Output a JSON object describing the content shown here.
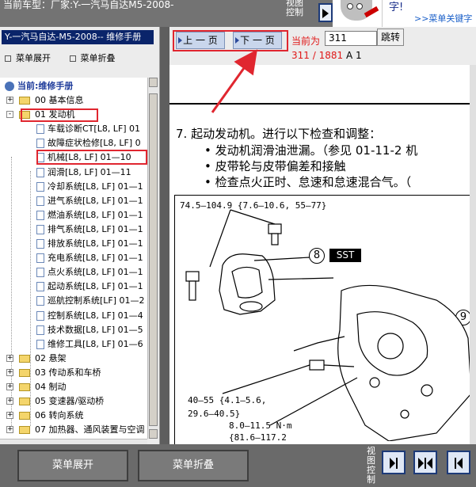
{
  "top": {
    "car_model": "当前车型：厂家:Y-一汽马自达M5-2008-",
    "view_control": "视图控制",
    "bubble_text": "字!",
    "bubble_link": ">>菜单关键字"
  },
  "left_panel": {
    "title": "Y-一汽马自达-M5-2008-- 维修手册",
    "expand_label": "菜单展开",
    "collapse_label": "菜单折叠",
    "current_label": "当前:维修手册",
    "tree": [
      {
        "label": "00 基本信息",
        "type": "folder",
        "level": 0,
        "expander": "+"
      },
      {
        "label": "01 发动机",
        "type": "folder",
        "level": 0,
        "expander": "-",
        "selected": true
      },
      {
        "label": "车载诊断CT[L8, LF] 01",
        "type": "doc",
        "level": 1
      },
      {
        "label": "故障症状检修[L8, LF] 0",
        "type": "doc",
        "level": 1
      },
      {
        "label": "机械[L8, LF] 01—10",
        "type": "doc",
        "level": 1,
        "active": true
      },
      {
        "label": "润滑[L8, LF] 01—11",
        "type": "doc",
        "level": 1
      },
      {
        "label": "冷却系统[L8, LF] 01—1",
        "type": "doc",
        "level": 1
      },
      {
        "label": "进气系统[L8, LF] 01—1",
        "type": "doc",
        "level": 1
      },
      {
        "label": "燃油系统[L8, LF] 01—1",
        "type": "doc",
        "level": 1
      },
      {
        "label": "排气系统[L8, LF] 01—1",
        "type": "doc",
        "level": 1
      },
      {
        "label": "排放系统[L8, LF] 01—1",
        "type": "doc",
        "level": 1
      },
      {
        "label": "充电系统[L8, LF] 01—1",
        "type": "doc",
        "level": 1
      },
      {
        "label": "点火系统[L8, LF] 01—1",
        "type": "doc",
        "level": 1
      },
      {
        "label": "起动系统[L8, LF] 01—1",
        "type": "doc",
        "level": 1
      },
      {
        "label": "巡航控制系统[LF] 01—2",
        "type": "doc",
        "level": 1
      },
      {
        "label": "控制系统[L8, LF] 01—4",
        "type": "doc",
        "level": 1
      },
      {
        "label": "技术数据[L8, LF] 01—5",
        "type": "doc",
        "level": 1
      },
      {
        "label": "维修工具[L8, LF] 01—6",
        "type": "doc",
        "level": 1
      },
      {
        "label": "02 悬架",
        "type": "folder",
        "level": 0,
        "expander": "+"
      },
      {
        "label": "03 传动系和车桥",
        "type": "folder",
        "level": 0,
        "expander": "+"
      },
      {
        "label": "04 制动",
        "type": "folder",
        "level": 0,
        "expander": "+"
      },
      {
        "label": "05 变速器/驱动桥",
        "type": "folder",
        "level": 0,
        "expander": "+"
      },
      {
        "label": "06 转向系统",
        "type": "folder",
        "level": 0,
        "expander": "+"
      },
      {
        "label": "07 加热器、通风装置与空调",
        "type": "folder",
        "level": 0,
        "expander": "+"
      }
    ]
  },
  "doc_toolbar": {
    "prev_label": "上 一 页",
    "next_label": "下 一 页",
    "current_page_label": "当前为",
    "page_input_value": "311",
    "jump_label": "跳转",
    "page_count": "311 / 1881",
    "page_suffix": "A 1"
  },
  "document": {
    "step": "7.  起动发动机。进行以下检查和调整：",
    "bullets": [
      "•  发动机润滑油泄漏。（参见 01-11-2 机",
      "•  皮带轮与皮带偏差和接触",
      "•  检查点火正时、怠速和怠速混合气。（"
    ],
    "figure": {
      "torque1": "74.5—104.9 {7.6—10.6, 55—77}",
      "sst": "SST",
      "callout8": "8",
      "callout9": "9",
      "torque2a": "40—55 {4.1—5.6,",
      "torque2b": "29.6—40.5}",
      "torque3a": "8.0—11.5 N·m",
      "torque3b": "{81.6—117.2"
    }
  },
  "bottom": {
    "expand_label": "菜单展开",
    "collapse_label": "菜单折叠",
    "view_control": "视图控制"
  },
  "colors": {
    "highlight_red": "#e0262f",
    "title_blue": "#0a246a"
  }
}
